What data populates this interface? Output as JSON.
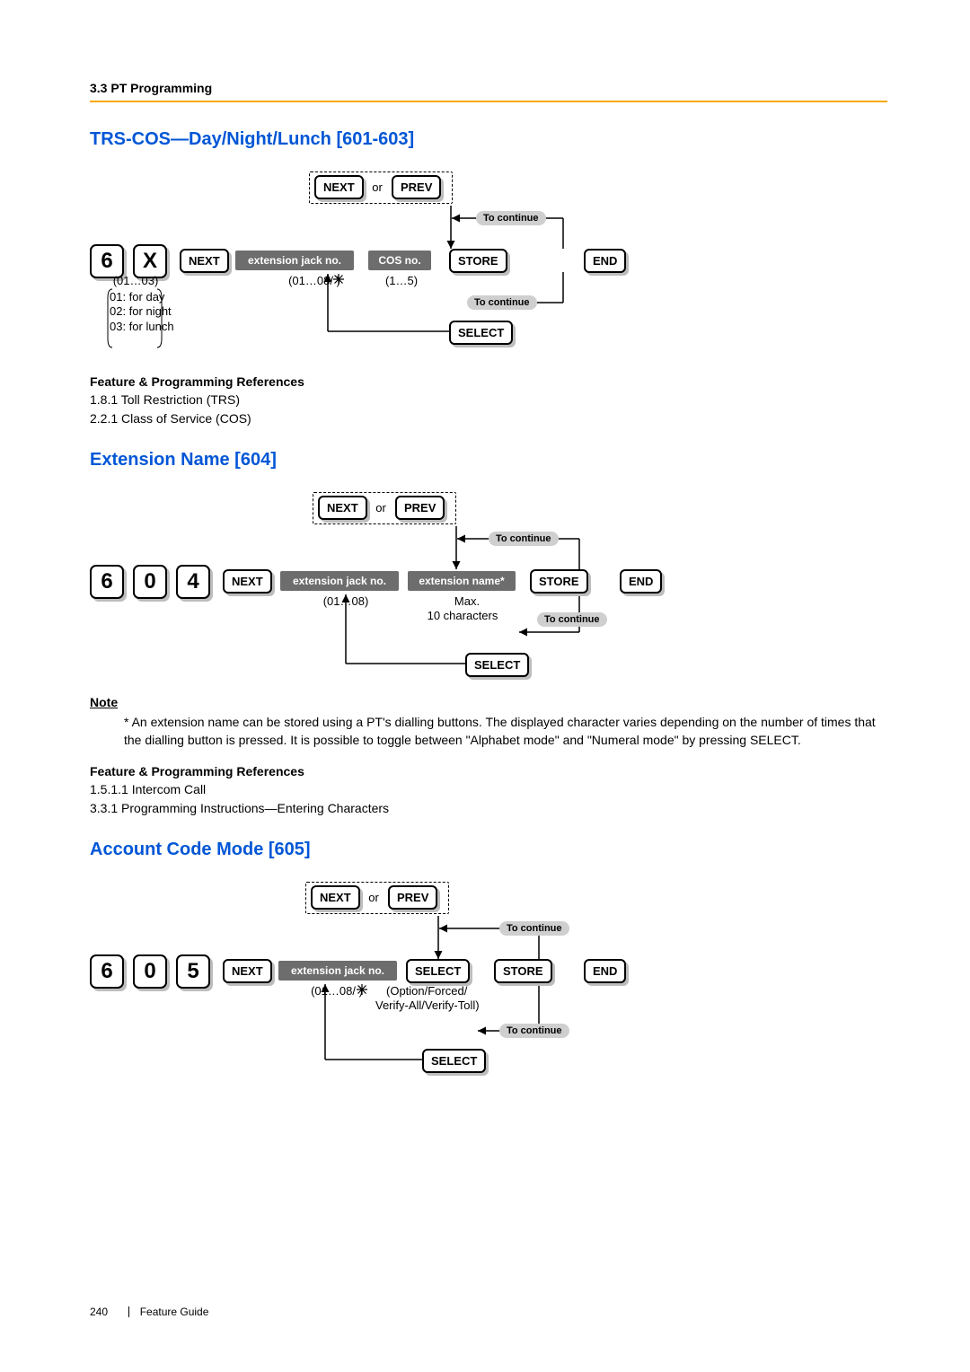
{
  "header": {
    "breadcrumb": "3.3 PT Programming"
  },
  "footer": {
    "page_no": "240",
    "guide": "Feature Guide"
  },
  "s1": {
    "title": "TRS-COS—Day/Night/Lunch [601-603]",
    "keys": [
      "6",
      "X"
    ],
    "next": "NEXT",
    "prev": "PREV",
    "or": "or",
    "jack": "extension jack no.",
    "jack_range": "(01…08/   )",
    "cos": "COS no.",
    "cos_range": "(1…5)",
    "store": "STORE",
    "end": "END",
    "select": "SELECT",
    "to_continue": "To continue",
    "x_range": "(01…03)",
    "x_legend1": "01: for day",
    "x_legend2": "02: for night",
    "x_legend3": "03: for lunch",
    "refs_heading": "Feature & Programming References",
    "refs1": "1.8.1 Toll Restriction (TRS)",
    "refs2": "2.2.1 Class of Service (COS)"
  },
  "s2": {
    "title": "Extension Name [604]",
    "keys": [
      "6",
      "0",
      "4"
    ],
    "next": "NEXT",
    "prev": "PREV",
    "or": "or",
    "jack": "extension jack no.",
    "jack_range": "(01…08)",
    "extname": "extension name*",
    "extname_note1": "Max.",
    "extname_note2": "10 characters",
    "store": "STORE",
    "end": "END",
    "select": "SELECT",
    "to_continue": "To continue",
    "note_heading": "Note",
    "note_body": "* An extension name can be stored using a PT's dialling buttons. The displayed character varies depending on the number of times that the dialling button is pressed. It is possible to toggle between \"Alphabet mode\" and \"Numeral mode\" by pressing SELECT.",
    "refs_heading": "Feature & Programming References",
    "refs1": "1.5.1.1 Intercom Call",
    "refs2": "3.3.1 Programming Instructions—Entering Characters"
  },
  "s3": {
    "title": "Account Code Mode [605]",
    "keys": [
      "6",
      "0",
      "5"
    ],
    "next": "NEXT",
    "prev": "PREV",
    "or": "or",
    "jack": "extension jack no.",
    "jack_range": "(01…08/   )",
    "select_inline": "SELECT",
    "select_note1": "(Option/Forced/",
    "select_note2": "Verify-All/Verify-Toll)",
    "store": "STORE",
    "end": "END",
    "select": "SELECT",
    "to_continue": "To continue"
  }
}
